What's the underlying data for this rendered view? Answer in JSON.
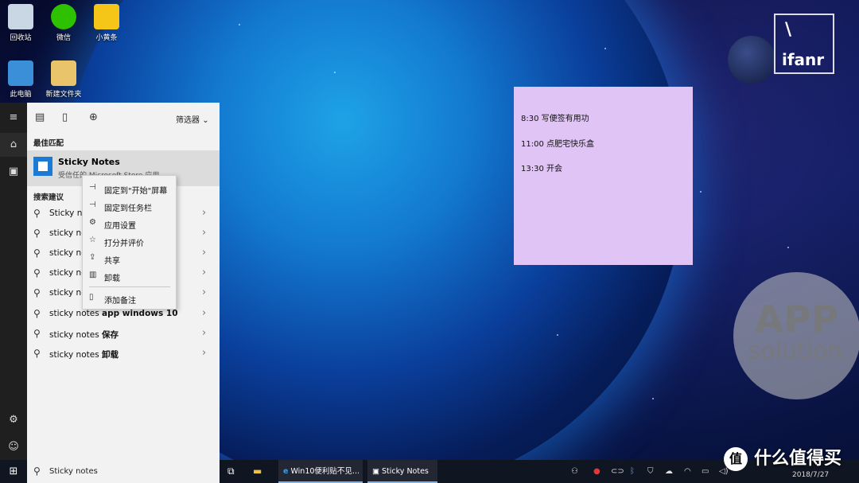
{
  "desktop": {
    "icons": [
      {
        "label": "回收站",
        "icon": "recycle-bin-icon",
        "color": "#c9d6e3"
      },
      {
        "label": "微信",
        "icon": "wechat-icon",
        "color": "#2dc100"
      },
      {
        "label": "小黄条",
        "icon": "note-app-icon",
        "color": "#f5c518"
      },
      {
        "label": "此电脑",
        "icon": "computer-icon",
        "color": "#3a8fd8"
      },
      {
        "label": "新建文件夹",
        "icon": "folder-icon",
        "color": "#e9c46a"
      }
    ],
    "logo_text": "ifanr",
    "watermark": {
      "line1": "APP",
      "line2": "solution"
    }
  },
  "sticky_note": {
    "color": "#e0c4f6",
    "lines": [
      "8:30   写便签有用功",
      "11:00 点肥宅快乐盒",
      "13:30 开会"
    ]
  },
  "start_menu": {
    "filter_label": "筛选器",
    "best_match_header": "最佳匹配",
    "best_match": {
      "title": "Sticky Notes",
      "subtitle": "受信任的 Microsoft Store 应用"
    },
    "suggestions_header": "搜索建议",
    "suggestions": [
      {
        "prefix": "Sticky no",
        "bold": ""
      },
      {
        "prefix": "sticky no",
        "bold": ""
      },
      {
        "prefix": "sticky no",
        "bold": ""
      },
      {
        "prefix": "sticky no",
        "bold": ""
      },
      {
        "prefix": "sticky no",
        "bold": ""
      },
      {
        "prefix": "sticky notes ",
        "bold": "app windows 10"
      },
      {
        "prefix": "sticky notes ",
        "bold": "保存"
      },
      {
        "prefix": "sticky notes ",
        "bold": "卸载"
      }
    ],
    "context_menu": [
      {
        "label": "固定到\"开始\"屏幕",
        "icon": "pin-icon"
      },
      {
        "label": "固定到任务栏",
        "icon": "pin-icon"
      },
      {
        "label": "应用设置",
        "icon": "gear-icon"
      },
      {
        "label": "打分并评价",
        "icon": "star-icon"
      },
      {
        "label": "共享",
        "icon": "share-icon"
      },
      {
        "label": "卸载",
        "icon": "trash-icon"
      },
      {
        "label": "添加备注",
        "icon": "note-icon"
      }
    ]
  },
  "taskbar": {
    "search_text": "Sticky notes",
    "windows": [
      {
        "label": "Win10便利贴不见..."
      },
      {
        "label": "Sticky Notes"
      }
    ],
    "brand_watermark": "什么值得买",
    "brand_badge": "值",
    "date": "2018/7/27"
  }
}
